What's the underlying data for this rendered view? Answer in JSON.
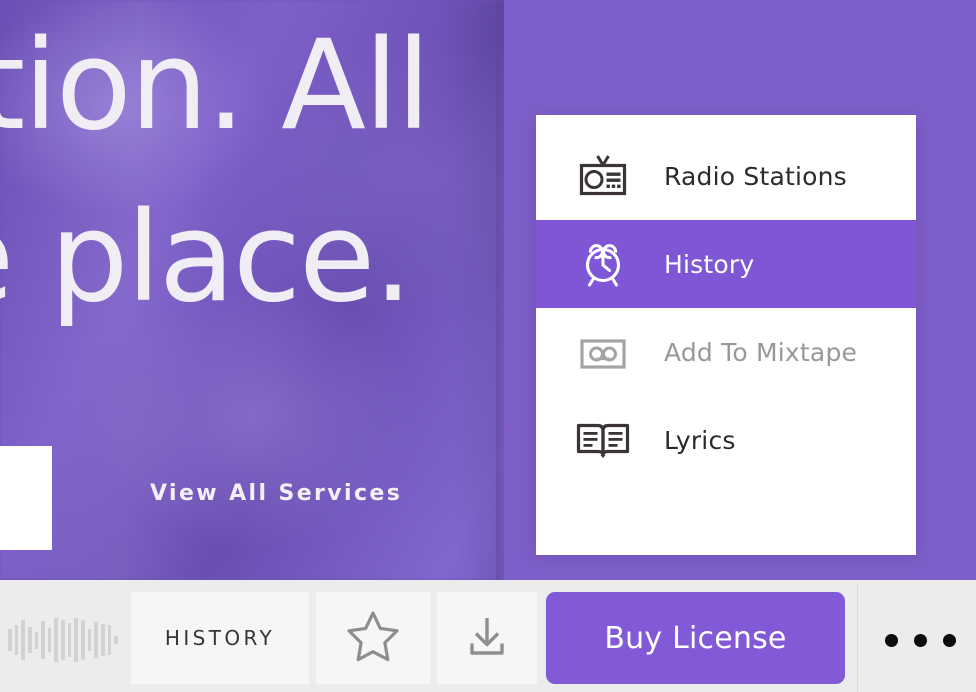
{
  "hero": {
    "headline_line_1": "uction. All",
    "headline_line_2": "e place.",
    "cta_link": "View All Services",
    "background_color": "#6f52b8"
  },
  "context_menu": {
    "items": [
      {
        "label": "Radio Stations",
        "icon": "radio-icon",
        "state": "normal",
        "text_color": "#2e2a2c"
      },
      {
        "label": "History",
        "icon": "alarm-clock-icon",
        "state": "selected",
        "text_color": "#ffffff"
      },
      {
        "label": "Add To Mixtape",
        "icon": "cassette-icon",
        "state": "disabled",
        "text_color": "#9b9799"
      },
      {
        "label": "Lyrics",
        "icon": "open-book-icon",
        "state": "normal",
        "text_color": "#2e2a2c"
      }
    ],
    "highlight_color": "#7f57d6",
    "panel_color": "#ffffff"
  },
  "toolbar": {
    "waveform_bar_heights": [
      22,
      30,
      40,
      26,
      17,
      38,
      24,
      44,
      40,
      34,
      44,
      40,
      22,
      36,
      32,
      30,
      8
    ],
    "history_label": "HISTORY",
    "favorite_icon": "star-icon",
    "download_icon": "download-icon",
    "buy_license_label": "Buy License",
    "buy_license_color": "#8259d6",
    "more_icon": "ellipsis-icon",
    "background_color": "#ececec",
    "tile_color": "#f6f6f6"
  }
}
